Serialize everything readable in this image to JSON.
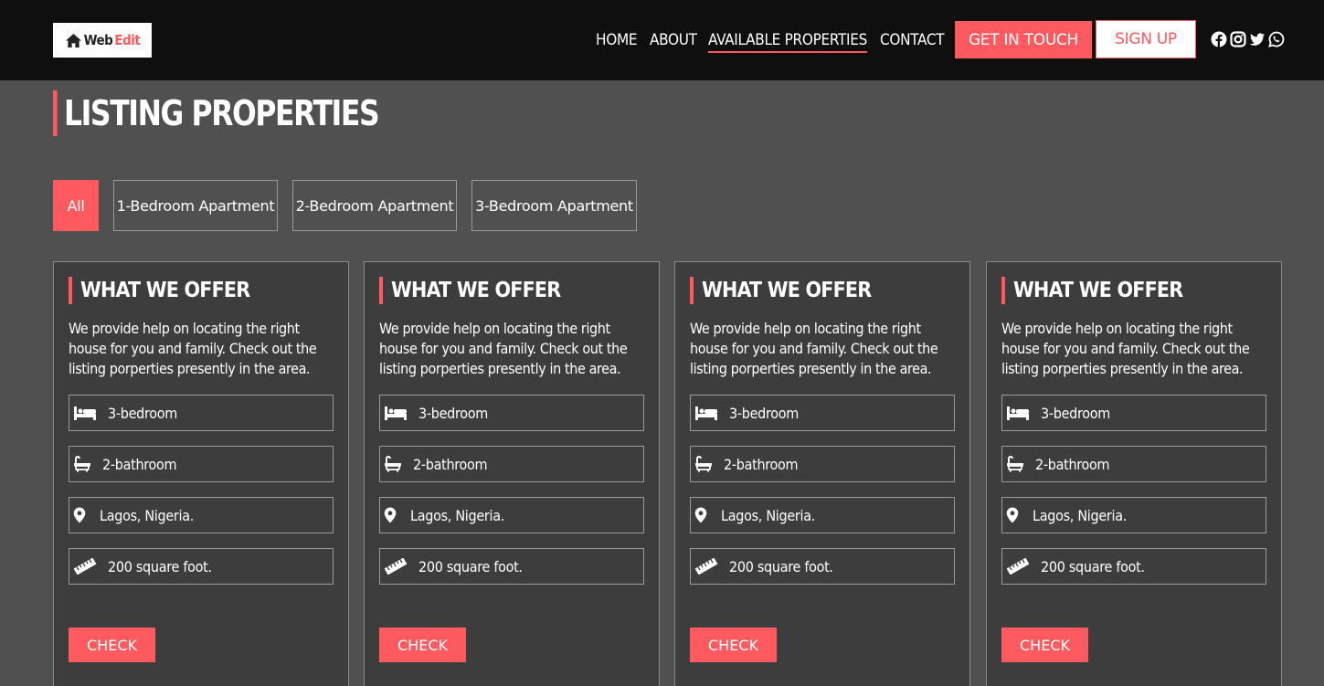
{
  "brand": {
    "part1": "Web",
    "part2": "Edit"
  },
  "nav": {
    "home": "HOME",
    "about": "ABOUT",
    "available": "AVAILABLE PROPERTIES",
    "contact": "CONTACT",
    "get_in_touch": "GET IN TOUCH",
    "sign_up": "SIGN UP"
  },
  "social_icons": [
    "facebook-icon",
    "instagram-icon",
    "twitter-icon",
    "whatsapp-icon"
  ],
  "page_title": "LISTING PROPERTIES",
  "filters": [
    "All",
    "1-Bedroom Apartment",
    "2-Bedroom Apartment",
    "3-Bedroom Apartment"
  ],
  "cards": [
    {
      "title": "WHAT WE OFFER",
      "description": "We provide help on locating the right house for you and family. Check out the listing porperties presently in the area.",
      "features": {
        "bedroom": "3-bedroom",
        "bathroom": "2-bathroom",
        "location": "Lagos, Nigeria.",
        "size": "200 square foot."
      },
      "button": "CHECK"
    },
    {
      "title": "WHAT WE OFFER",
      "description": "We provide help on locating the right house for you and family. Check out the listing porperties presently in the area.",
      "features": {
        "bedroom": "3-bedroom",
        "bathroom": "2-bathroom",
        "location": "Lagos, Nigeria.",
        "size": "200 square foot."
      },
      "button": "CHECK"
    },
    {
      "title": "WHAT WE OFFER",
      "description": "We provide help on locating the right house for you and family. Check out the listing porperties presently in the area.",
      "features": {
        "bedroom": "3-bedroom",
        "bathroom": "2-bathroom",
        "location": "Lagos, Nigeria.",
        "size": "200 square foot."
      },
      "button": "CHECK"
    },
    {
      "title": "WHAT WE OFFER",
      "description": "We provide help on locating the right house for you and family. Check out the listing porperties presently in the area.",
      "features": {
        "bedroom": "3-bedroom",
        "bathroom": "2-bathroom",
        "location": "Lagos, Nigeria.",
        "size": "200 square foot."
      },
      "button": "CHECK"
    }
  ],
  "colors": {
    "accent": "#ff5a5f",
    "header_bg": "#0f0f0f",
    "page_bg": "#505050",
    "card_bg": "#3d3d3d"
  }
}
